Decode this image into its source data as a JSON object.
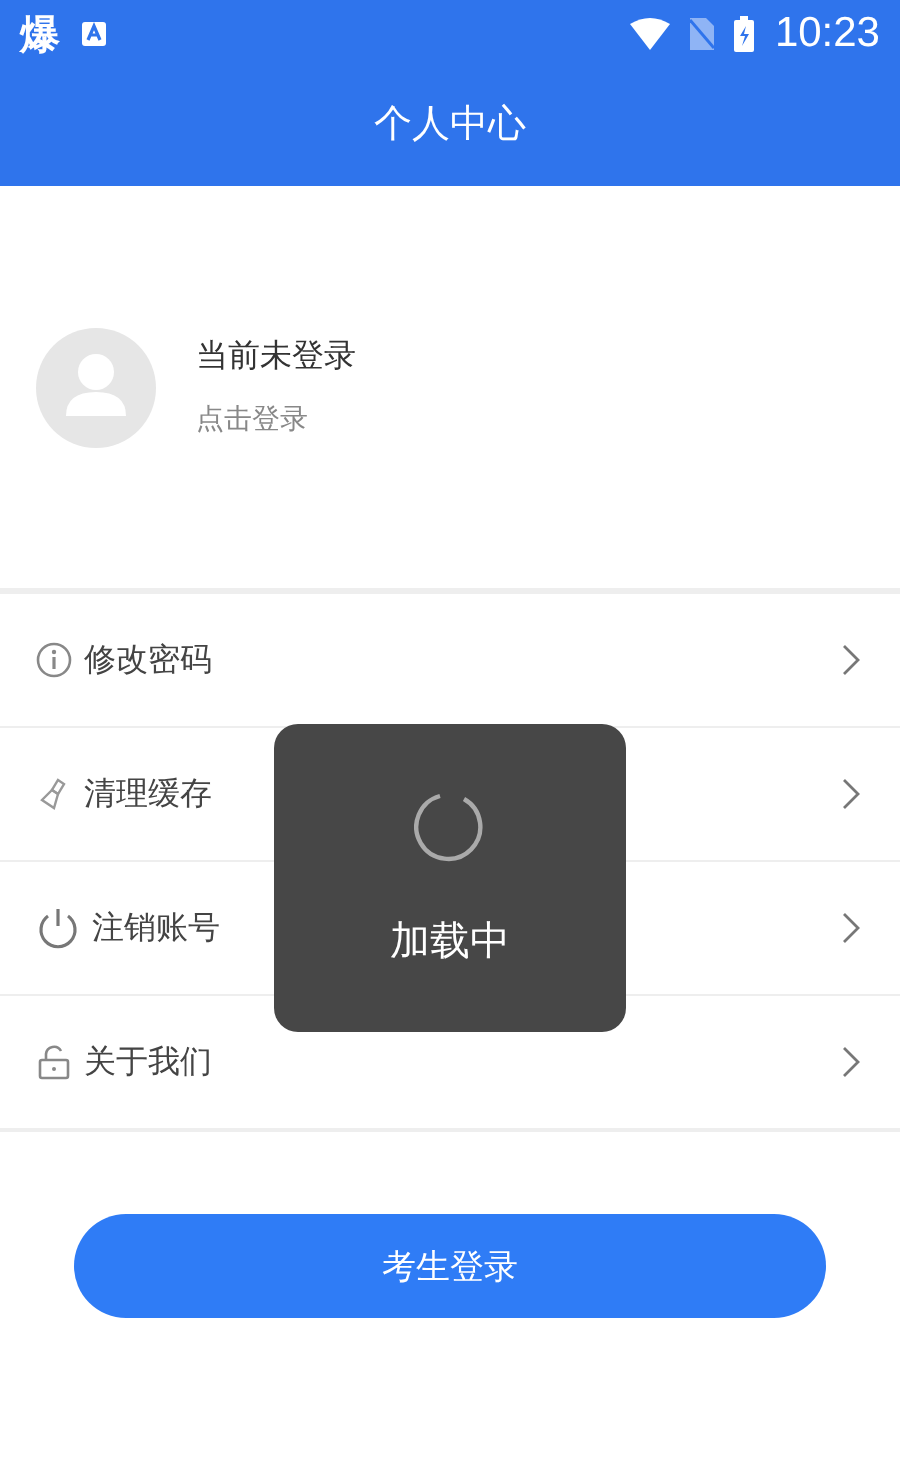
{
  "status_bar": {
    "app_glyph": "爆",
    "time": "10:23"
  },
  "header": {
    "title": "个人中心"
  },
  "profile": {
    "name": "当前未登录",
    "action": "点击登录"
  },
  "menu": [
    {
      "kind": "info",
      "label": "修改密码"
    },
    {
      "kind": "broom",
      "label": "清理缓存"
    },
    {
      "kind": "power",
      "label": "注销账号"
    },
    {
      "kind": "lock",
      "label": "关于我们"
    }
  ],
  "login_button": "考生登录",
  "loading": {
    "text": "加载中"
  }
}
